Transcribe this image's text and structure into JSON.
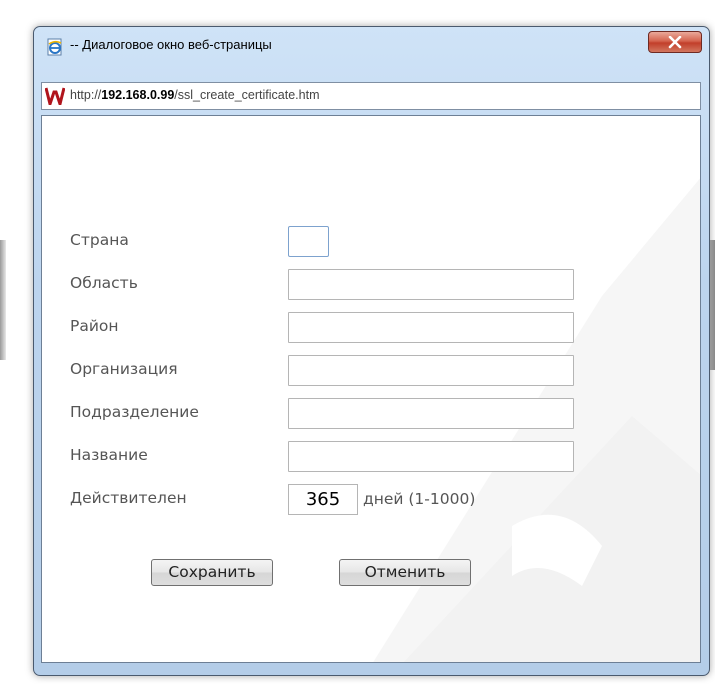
{
  "window": {
    "title": "-- Диалоговое окно веб-страницы",
    "close_symbol": "×"
  },
  "address": {
    "prefix": "http://",
    "host": "192.168.0.99",
    "path": "/ssl_create_certificate.htm"
  },
  "form": {
    "country_label": "Страна",
    "region_label": "Область",
    "district_label": "Район",
    "organization_label": "Организация",
    "department_label": "Подразделение",
    "name_label": "Название",
    "valid_label": "Действителен",
    "country_value": "",
    "region_value": "",
    "district_value": "",
    "organization_value": "",
    "department_value": "",
    "name_value": "",
    "valid_days_value": "365",
    "valid_days_suffix": "дней (1-1000)"
  },
  "buttons": {
    "save_label": "Сохранить",
    "cancel_label": "Отменить"
  },
  "icons": {
    "title_icon": "ie-page-icon",
    "address_icon": "site-logo-icon",
    "close_icon": "close-icon"
  },
  "colors": {
    "titlebar": "#bcd4ee",
    "close_button": "#c23f2a",
    "label_text": "#555555"
  }
}
